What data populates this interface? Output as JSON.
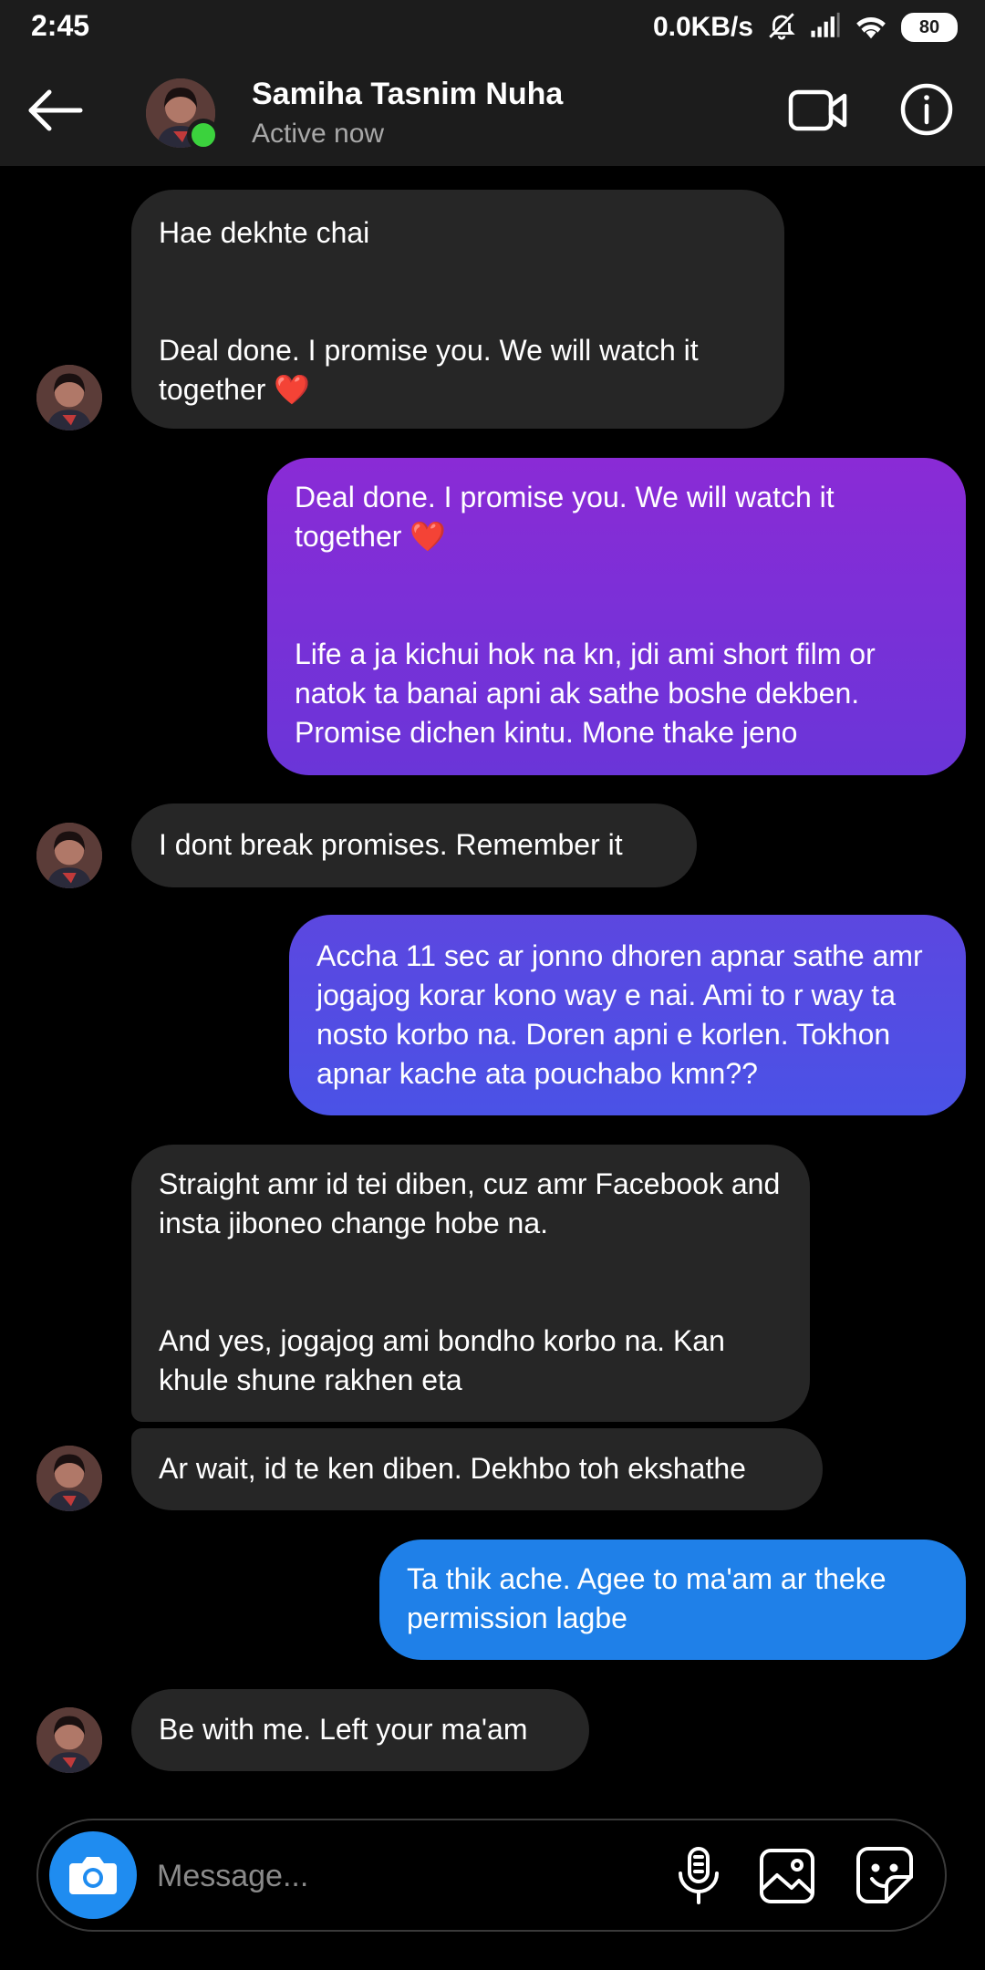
{
  "status_bar": {
    "time": "2:45",
    "net_speed": "0.0KB/s",
    "battery": "80"
  },
  "header": {
    "name": "Samiha Tasnim Nuha",
    "status": "Active now"
  },
  "colors": {
    "received": "#262626",
    "sent_top": "#8a2bd6",
    "sent_mid": "#5a4be3",
    "sent_bottom": "#1f80e8",
    "online": "#3bd23d"
  },
  "messages": [
    {
      "from": "them",
      "paras": [
        "Hae dekhte chai",
        "Deal done. I promise you. We will watch it together ❤️"
      ]
    },
    {
      "from": "me",
      "paras": [
        "Deal done. I promise you. We will watch it together ❤️",
        "Life a ja kichui hok na kn, jdi ami short film or natok ta banai apni ak sathe boshe dekben. Promise dichen kintu. Mone thake jeno"
      ]
    },
    {
      "from": "them",
      "paras": [
        "I dont break promises. Remember it"
      ]
    },
    {
      "from": "me",
      "paras": [
        "Accha 11 sec ar jonno dhoren apnar sathe amr jogajog korar kono way e nai. Ami to r way ta nosto korbo na. Doren apni e korlen. Tokhon apnar kache ata pouchabo kmn??"
      ]
    },
    {
      "from": "them",
      "paras": [
        "Straight amr id tei diben, cuz amr Facebook and insta jiboneo change hobe na.",
        "And yes, jogajog ami bondho korbo na. Kan khule shune rakhen eta"
      ]
    },
    {
      "from": "them",
      "paras": [
        "Ar wait, id te ken diben. Dekhbo toh ekshathe"
      ]
    },
    {
      "from": "me",
      "paras": [
        "Ta thik ache. Agee to ma'am ar theke permission lagbe"
      ]
    },
    {
      "from": "them",
      "paras": [
        "Be with me. Left your ma'am"
      ]
    }
  ],
  "composer": {
    "placeholder": "Message..."
  }
}
